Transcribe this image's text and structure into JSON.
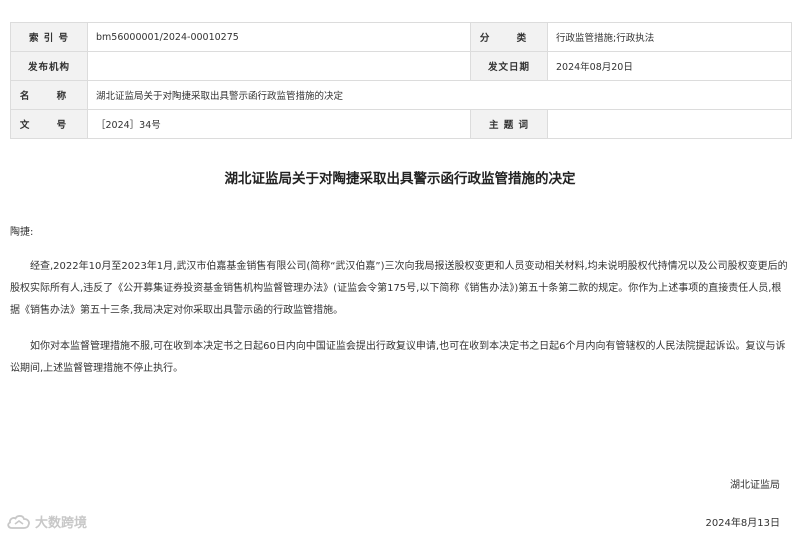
{
  "meta": {
    "index_label": "索 引 号",
    "index_value": "bm56000001/2024-00010275",
    "category_label": "分 类",
    "category_value": "行政监管措施;行政执法",
    "issuer_label": "发布机构",
    "issuer_value": "",
    "date_label": "发文日期",
    "date_value": "2024年08月20日",
    "name_label": "名 称",
    "name_value": "湖北证监局关于对陶捷采取出具警示函行政监管措施的决定",
    "docno_label": "文 号",
    "docno_value": "［2024］34号",
    "subject_label": "主 题 词",
    "subject_value": ""
  },
  "document": {
    "title": "湖北证监局关于对陶捷采取出具警示函行政监管措施的决定",
    "addressee": "陶捷:",
    "paragraphs": [
      "经查,2022年10月至2023年1月,武汉市伯嘉基金销售有限公司(简称“武汉伯嘉”)三次向我局报送股权变更和人员变动相关材料,均未说明股权代持情况以及公司股权变更后的股权实际所有人,违反了《公开募集证券投资基金销售机构监督管理办法》(证监会令第175号,以下简称《销售办法》)第五十条第二款的规定。你作为上述事项的直接责任人员,根据《销售办法》第五十三条,我局决定对你采取出具警示函的行政监管措施。",
      "如你对本监督管理措施不服,可在收到本决定书之日起60日内向中国证监会提出行政复议申请,也可在收到本决定书之日起6个月内向有管辖权的人民法院提起诉讼。复议与诉讼期间,上述监督管理措施不停止执行。"
    ],
    "issuer": "湖北证监局",
    "date": "2024年8月13日"
  },
  "watermark": {
    "text": "大数跨境",
    "icon": "cloud-logo-icon",
    "color": "#c8c8c8"
  }
}
